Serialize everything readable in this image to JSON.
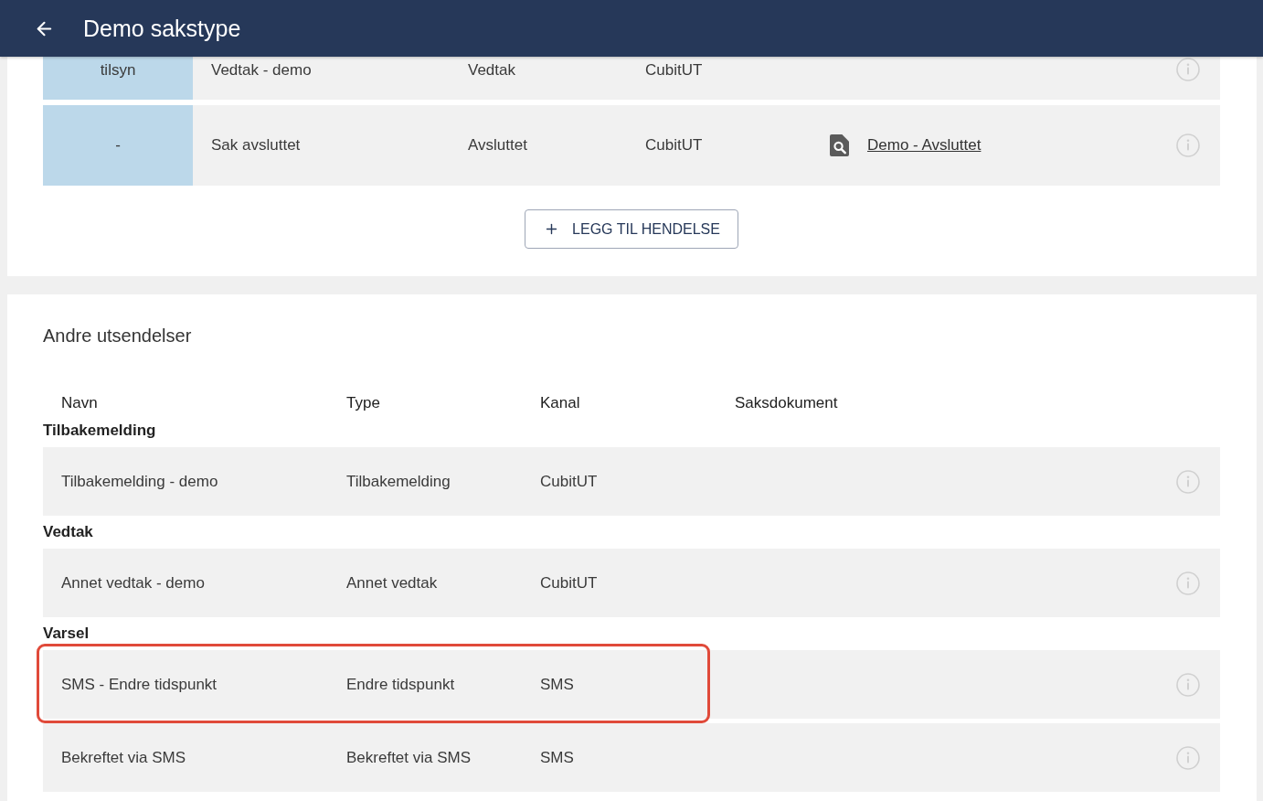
{
  "header": {
    "title": "Demo sakstype"
  },
  "events": {
    "rows": [
      {
        "column_1": "tilsyn",
        "column_2": "Vedtak - demo",
        "column_3": "Vedtak",
        "column_4": "CubitUT"
      },
      {
        "column_1": "-",
        "column_2": "Sak avsluttet",
        "column_3": "Avsluttet",
        "column_4": "CubitUT",
        "column_5": "Demo - Avsluttet"
      }
    ],
    "add_button": "LEGG TIL HENDELSE"
  },
  "other_mailings": {
    "title": "Andre utsendelser",
    "columns": [
      "Navn",
      "Type",
      "Kanal",
      "Saksdokument"
    ],
    "groups": [
      {
        "label": "Tilbakemelding",
        "rows": [
          {
            "name": "Tilbakemelding - demo",
            "type": "Tilbakemelding",
            "channel": "CubitUT",
            "highlighted": false
          }
        ]
      },
      {
        "label": "Vedtak",
        "rows": [
          {
            "name": "Annet vedtak - demo",
            "type": "Annet vedtak",
            "channel": "CubitUT",
            "highlighted": false
          }
        ]
      },
      {
        "label": "Varsel",
        "rows": [
          {
            "name": "SMS - Endre tidspunkt",
            "type": "Endre tidspunkt",
            "channel": "SMS",
            "highlighted": true
          },
          {
            "name": "Bekreftet via SMS",
            "type": "Bekreftet via SMS",
            "channel": "SMS",
            "highlighted": false
          }
        ]
      }
    ]
  }
}
